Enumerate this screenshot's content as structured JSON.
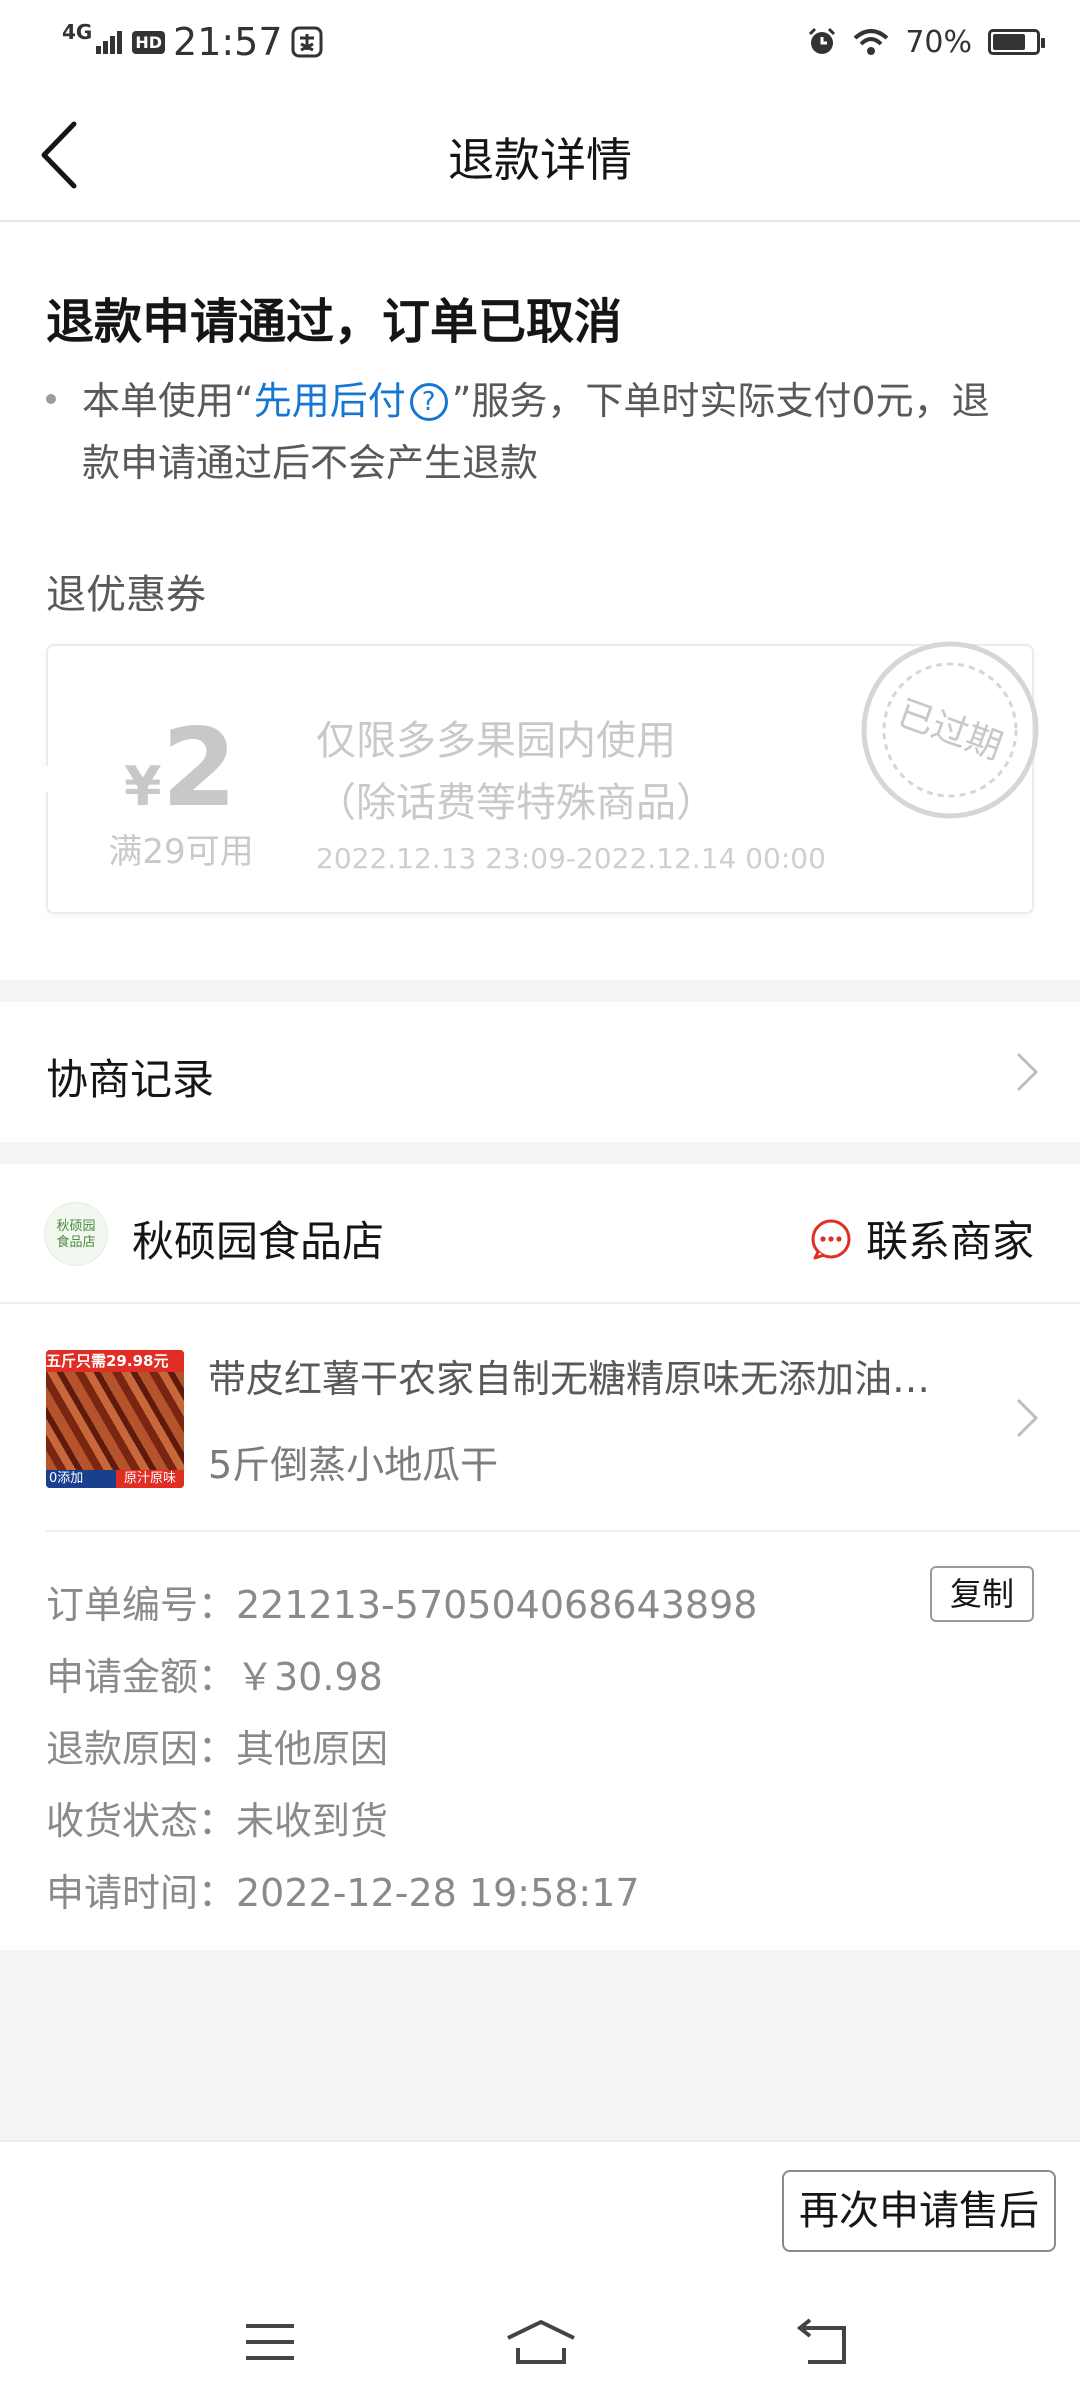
{
  "status_bar": {
    "network": "4G",
    "hd": "HD",
    "time": "21:57",
    "battery": "70%"
  },
  "header": {
    "title": "退款详情"
  },
  "refund": {
    "status_title": "退款申请通过，订单已取消",
    "desc_prefix": "本单使用“",
    "desc_link": "先用后付",
    "desc_suffix": "”服务，下单时实际支付0元，退款申请通过后不会产生退款"
  },
  "coupon": {
    "section_label": "退优惠券",
    "currency": "¥",
    "amount": "2",
    "threshold": "满29可用",
    "scope_line1": "仅限多多果园内使用",
    "scope_line2": "（除话费等特殊商品）",
    "valid_period": "2022.12.13 23:09-2022.12.14 00:00",
    "stamp_text": "已过期"
  },
  "negotiation": {
    "label": "协商记录"
  },
  "store": {
    "logo_text_1": "秋硕园",
    "logo_text_2": "食品店",
    "name": "秋硕园食品店",
    "contact_label": "联系商家"
  },
  "product": {
    "thumb_top_text": "五斤只需29.98元",
    "thumb_bottom_left": "0添加",
    "thumb_bottom_right": "原汁原味",
    "name": "带皮红薯干农家自制无糖精原味无添加油地瓜干",
    "spec": "5斤倒蒸小地瓜干"
  },
  "order_info": {
    "order_no": "订单编号：221213-570504068643898",
    "copy_label": "复制",
    "amount": "申请金额：￥30.98",
    "reason": "退款原因：其他原因",
    "receipt_status": "收货状态：未收到货",
    "apply_time": "申请时间：2022-12-28 19:58:17"
  },
  "actions": {
    "reapply_label": "再次申请售后"
  }
}
